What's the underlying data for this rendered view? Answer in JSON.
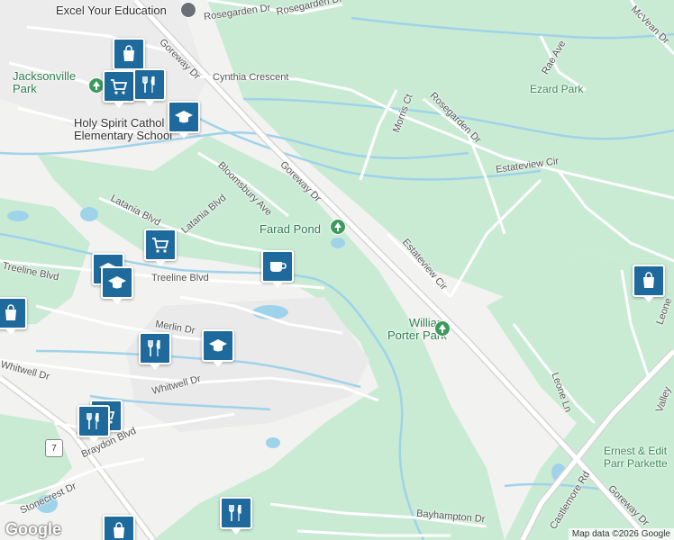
{
  "colors": {
    "water": "#9fd3ea",
    "park": "#c9ebd4",
    "road": "#ffffff",
    "arterial": "#d8d8d8",
    "pin": "#1e6a9c",
    "land": "#f2f2f0"
  },
  "places": {
    "excel": "Excel Your Education",
    "jacksonville": "Jacksonville\nPark",
    "holy_spirit": "Holy Spirit Cathol\nElementary School",
    "farad": "Farad Pond",
    "william": "William\nPorter Park",
    "ezard": "Ezard Park",
    "ernest": "Ernest & Edit\nParr Parkette"
  },
  "streets": {
    "rosegarden_top1": "Rosegarden Dr",
    "rosegarden_top2": "Rosegarden Dr",
    "goreway_top": "Goreway Dr",
    "cynthia": "Cynthia Crescent",
    "morris": "Morris Ct",
    "rosegarden_mid": "Rosegarden Dr",
    "mcvean": "McVean Dr",
    "rae": "Rae Ave",
    "estateview1": "Estateview Cir",
    "estateview2": "Estateview Cir",
    "goreway_mid": "Goreway Dr",
    "bloomsbury": "Bloomsbury Ave",
    "latania1": "Latania Blvd",
    "latania2": "Latania Blvd",
    "treeline1": "Treeline Blvd",
    "treeline2": "Treeline Blvd",
    "merlin": "Merlin Dr",
    "whitwell1": "Whitwell Dr",
    "whitwell2": "Whitwell Dr",
    "braydon": "Braydon Blvd",
    "stonecrest": "Stonecrest Dr",
    "bayhampton": "Bayhampton Dr",
    "leone1": "Leone Ln",
    "leone2": "Leone",
    "valley": "Valley",
    "castlemore": "Castlemore Rd",
    "goreway_bot": "Goreway Dr",
    "route": "7"
  },
  "markers": [
    {
      "id": "bag-1",
      "icon": "shopping-bag-icon"
    },
    {
      "id": "cart-1",
      "icon": "shopping-cart-icon"
    },
    {
      "id": "food-1",
      "icon": "restaurant-icon"
    },
    {
      "id": "school-1",
      "icon": "school-icon"
    },
    {
      "id": "cart-2",
      "icon": "shopping-cart-icon"
    },
    {
      "id": "cafe-1",
      "icon": "cafe-icon"
    },
    {
      "id": "school-2",
      "icon": "school-icon"
    },
    {
      "id": "school-3",
      "icon": "school-icon"
    },
    {
      "id": "bag-2",
      "icon": "shopping-bag-icon"
    },
    {
      "id": "food-2",
      "icon": "restaurant-icon"
    },
    {
      "id": "school-4",
      "icon": "school-icon"
    },
    {
      "id": "cart-3",
      "icon": "shopping-cart-icon"
    },
    {
      "id": "food-3",
      "icon": "restaurant-icon"
    },
    {
      "id": "bag-3",
      "icon": "shopping-bag-icon"
    },
    {
      "id": "food-4",
      "icon": "restaurant-icon"
    },
    {
      "id": "bag-4",
      "icon": "shopping-bag-icon"
    }
  ],
  "branding": {
    "logo": "Google",
    "attribution": "Map data ©2026 Google"
  }
}
